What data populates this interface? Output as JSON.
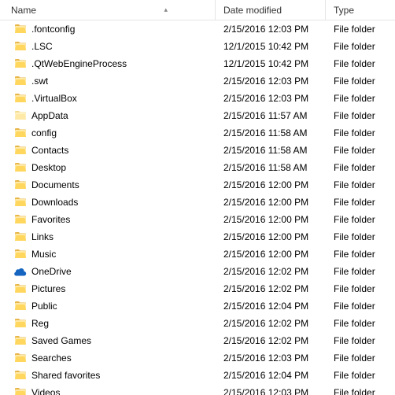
{
  "columns": {
    "name": "Name",
    "date": "Date modified",
    "type": "Type"
  },
  "sort": {
    "column": "name",
    "direction": "asc",
    "glyph": "▴"
  },
  "items": [
    {
      "name": ".fontconfig",
      "date": "2/15/2016 12:03 PM",
      "type": "File folder",
      "icon": "folder"
    },
    {
      "name": ".LSC",
      "date": "12/1/2015 10:42 PM",
      "type": "File folder",
      "icon": "folder"
    },
    {
      "name": ".QtWebEngineProcess",
      "date": "12/1/2015 10:42 PM",
      "type": "File folder",
      "icon": "folder"
    },
    {
      "name": ".swt",
      "date": "2/15/2016 12:03 PM",
      "type": "File folder",
      "icon": "folder"
    },
    {
      "name": ".VirtualBox",
      "date": "2/15/2016 12:03 PM",
      "type": "File folder",
      "icon": "folder"
    },
    {
      "name": "AppData",
      "date": "2/15/2016 11:57 AM",
      "type": "File folder",
      "icon": "folder-light"
    },
    {
      "name": "config",
      "date": "2/15/2016 11:58 AM",
      "type": "File folder",
      "icon": "folder"
    },
    {
      "name": "Contacts",
      "date": "2/15/2016 11:58 AM",
      "type": "File folder",
      "icon": "folder"
    },
    {
      "name": "Desktop",
      "date": "2/15/2016 11:58 AM",
      "type": "File folder",
      "icon": "folder"
    },
    {
      "name": "Documents",
      "date": "2/15/2016 12:00 PM",
      "type": "File folder",
      "icon": "folder"
    },
    {
      "name": "Downloads",
      "date": "2/15/2016 12:00 PM",
      "type": "File folder",
      "icon": "folder"
    },
    {
      "name": "Favorites",
      "date": "2/15/2016 12:00 PM",
      "type": "File folder",
      "icon": "folder"
    },
    {
      "name": "Links",
      "date": "2/15/2016 12:00 PM",
      "type": "File folder",
      "icon": "folder"
    },
    {
      "name": "Music",
      "date": "2/15/2016 12:00 PM",
      "type": "File folder",
      "icon": "folder"
    },
    {
      "name": "OneDrive",
      "date": "2/15/2016 12:02 PM",
      "type": "File folder",
      "icon": "onedrive"
    },
    {
      "name": "Pictures",
      "date": "2/15/2016 12:02 PM",
      "type": "File folder",
      "icon": "folder"
    },
    {
      "name": "Public",
      "date": "2/15/2016 12:04 PM",
      "type": "File folder",
      "icon": "folder"
    },
    {
      "name": "Reg",
      "date": "2/15/2016 12:02 PM",
      "type": "File folder",
      "icon": "folder"
    },
    {
      "name": "Saved Games",
      "date": "2/15/2016 12:02 PM",
      "type": "File folder",
      "icon": "folder"
    },
    {
      "name": "Searches",
      "date": "2/15/2016 12:03 PM",
      "type": "File folder",
      "icon": "folder"
    },
    {
      "name": "Shared favorites",
      "date": "2/15/2016 12:04 PM",
      "type": "File folder",
      "icon": "folder"
    },
    {
      "name": "Videos",
      "date": "2/15/2016 12:03 PM",
      "type": "File folder",
      "icon": "folder"
    }
  ],
  "icons": {
    "folder": "folder-icon",
    "folder-light": "folder-light-icon",
    "onedrive": "onedrive-icon"
  }
}
